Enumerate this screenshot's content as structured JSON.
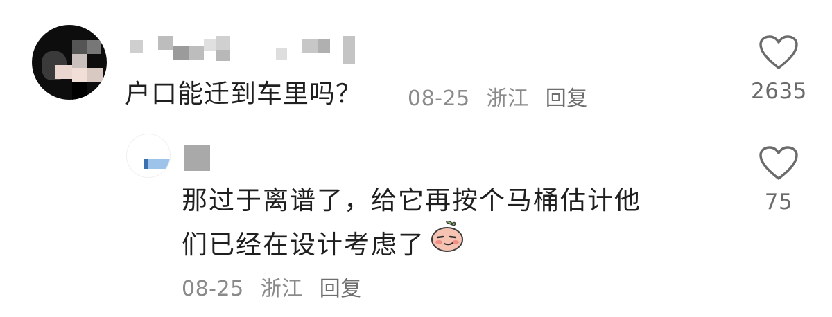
{
  "comment": {
    "text": "户口能迁到车里吗？",
    "date": "08-25",
    "location": "浙江",
    "reply_label": "回复",
    "likes": "2635"
  },
  "reply": {
    "text_line1": "那过于离谱了，给它再按个马桶估计他",
    "text_line2": "们已经在设计考虑了",
    "date": "08-25",
    "location": "浙江",
    "reply_label": "回复",
    "likes": "75",
    "emoji": "peach-face-emoji"
  },
  "colors": {
    "text": "#1f1f1f",
    "meta": "#8a8a8a",
    "heart_stroke": "#6b6b6b"
  },
  "icons": [
    "heart-icon",
    "peach-face-emoji"
  ]
}
